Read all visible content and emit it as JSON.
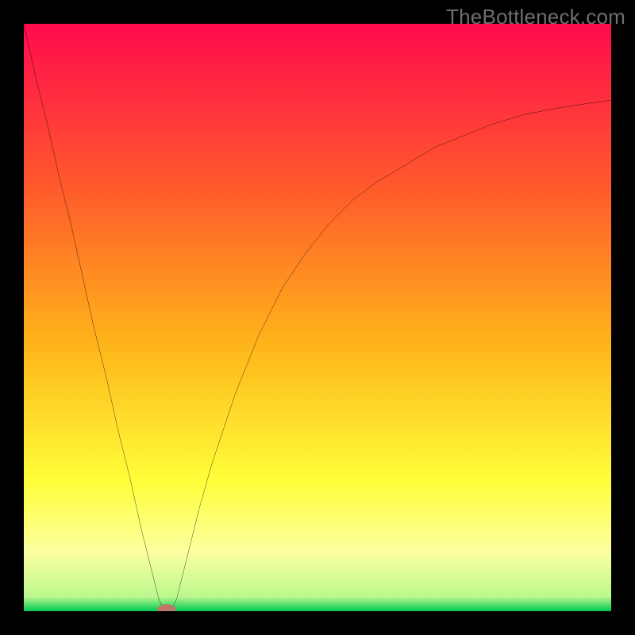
{
  "watermark": "TheBottleneck.com",
  "chart_data": {
    "type": "line",
    "title": "",
    "xlabel": "",
    "ylabel": "",
    "xlim": [
      0,
      100
    ],
    "ylim": [
      0,
      100
    ],
    "grid": false,
    "background": {
      "type": "vertical-gradient",
      "stops": [
        {
          "pos": 0.0,
          "color": "#ff0b4e"
        },
        {
          "pos": 0.28,
          "color": "#ff5a2b"
        },
        {
          "pos": 0.55,
          "color": "#ffb61a"
        },
        {
          "pos": 0.78,
          "color": "#ffff3a"
        },
        {
          "pos": 0.9,
          "color": "#fbffa0"
        },
        {
          "pos": 0.975,
          "color": "#bdf88e"
        },
        {
          "pos": 1.0,
          "color": "#00c853"
        }
      ]
    },
    "series": [
      {
        "name": "bottleneck-curve",
        "color": "#000000",
        "stroke_width": 2,
        "x": [
          0,
          2,
          4,
          6,
          8,
          10,
          12,
          14,
          16,
          18,
          20,
          22,
          23,
          24,
          25,
          26,
          27,
          28,
          30,
          32,
          34,
          36,
          38,
          40,
          44,
          48,
          52,
          56,
          60,
          65,
          70,
          75,
          80,
          85,
          90,
          95,
          100
        ],
        "y": [
          100,
          91,
          83,
          74,
          66,
          57,
          48,
          40,
          31,
          23,
          14,
          6,
          2,
          0,
          0,
          2,
          6,
          10,
          18,
          25,
          31,
          37,
          42,
          47,
          55,
          61,
          66,
          70,
          73,
          76,
          79,
          81,
          83,
          84.5,
          85.5,
          86.3,
          87
        ]
      }
    ],
    "marker": {
      "name": "minimum-point",
      "x": 24.3,
      "y": 0.2,
      "rx": 1.6,
      "ry": 1.0,
      "color": "#c1766d"
    }
  }
}
